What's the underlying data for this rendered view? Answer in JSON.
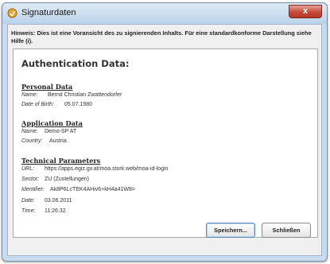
{
  "window": {
    "title": "Signaturdaten",
    "close_label": "x"
  },
  "hint": "Hinweis: Dies ist eine Voransicht des zu signierenden Inhalts. Für eine standardkonforme Darstellung siehe Hilfe (i).",
  "auth_title": "Authentication Data:",
  "personal": {
    "title": "Personal Data",
    "name_label": "Name:",
    "name_value": "Bernd Christian Zwattendorfer",
    "dob_label": "Date of Birth:",
    "dob_value": "05.07.1980"
  },
  "application": {
    "title": "Application Data",
    "name_label": "Name:",
    "name_value": "Demo-SP AT",
    "country_label": "Country:",
    "country_value": "Austria"
  },
  "technical": {
    "title": "Technical Parameters",
    "url_label": "URL:",
    "url_value": "https://apps.egiz.gv.at/moa.stork.web/moa-id-login",
    "sector_label": "Sector:",
    "sector_value": "ZU (Zustellungen)",
    "identifier_label": "Identifier:",
    "identifier_value": "Ak8P6LcTEK4AHiv6+kH4a41W8=",
    "date_label": "Date:",
    "date_value": "03.06.2011",
    "time_label": "Time:",
    "time_value": "11:26:32"
  },
  "buttons": {
    "save_label": "Speichern...",
    "close_label": "Schließen"
  }
}
